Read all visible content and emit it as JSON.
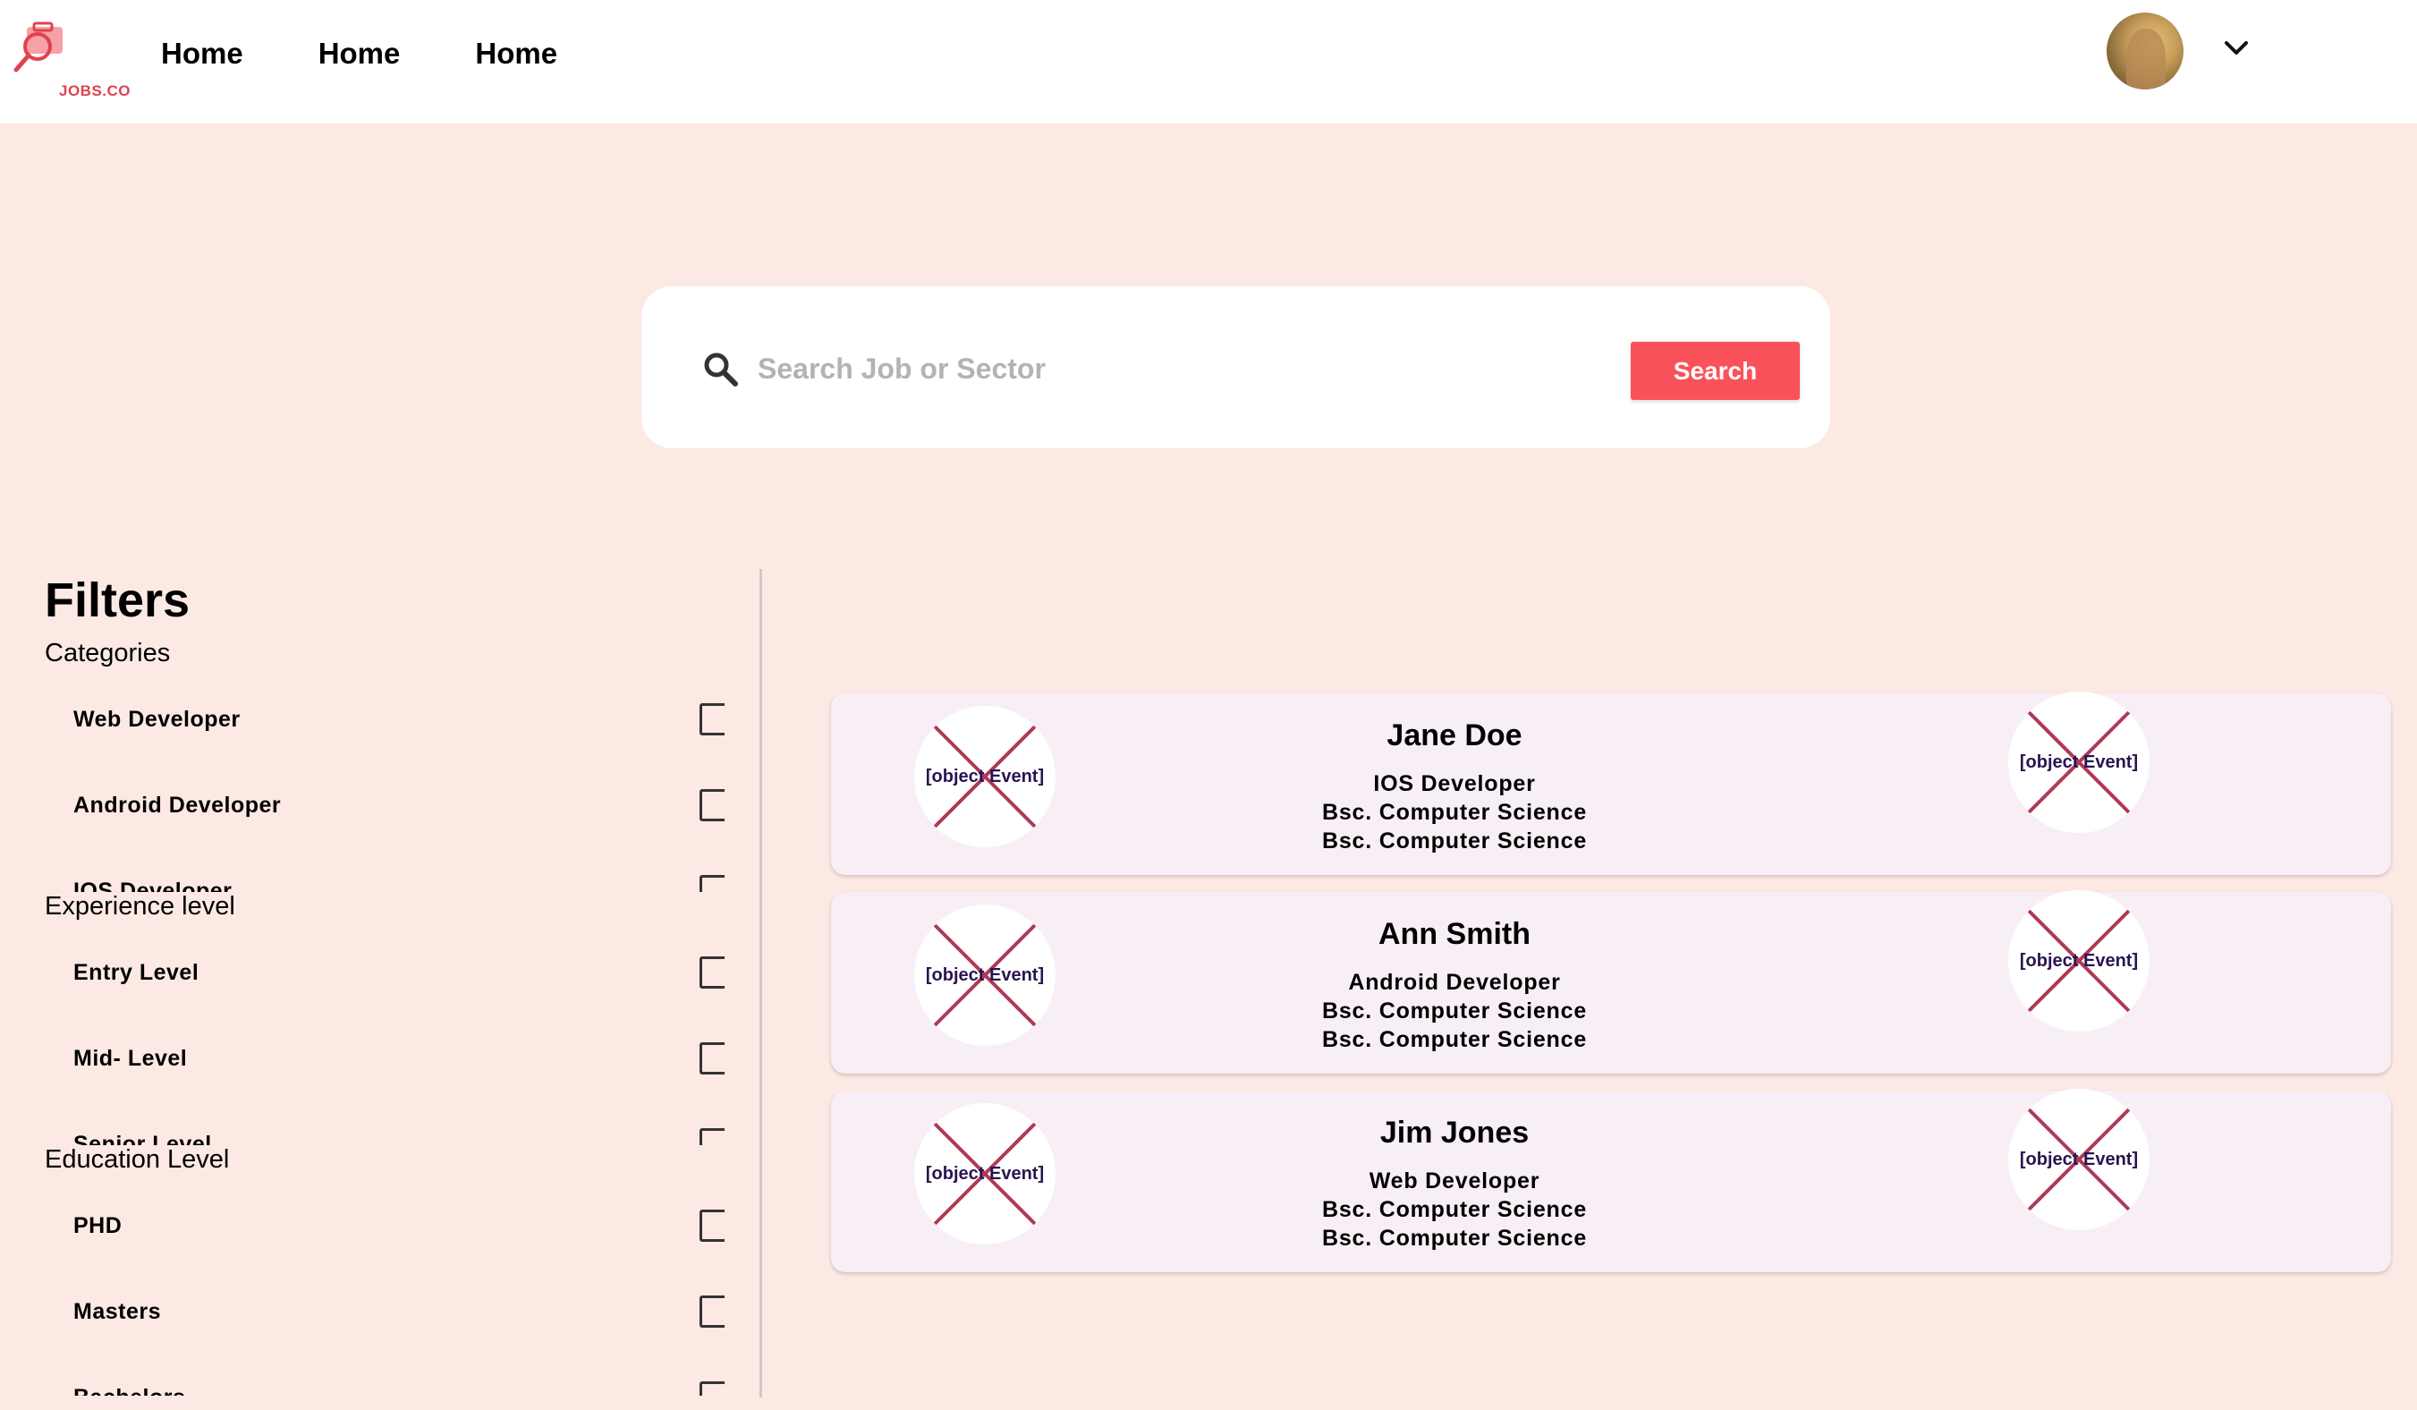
{
  "header": {
    "logo_text": "JOBS.CO",
    "nav": [
      "Home",
      "Home",
      "Home"
    ]
  },
  "search": {
    "placeholder": "Search Job or Sector",
    "button_label": "Search"
  },
  "filters": {
    "title": "Filters",
    "groups": [
      {
        "title": "Categories",
        "items": [
          "Web Developer",
          "Android Developer",
          "IOS Developer"
        ]
      },
      {
        "title": "Experience level",
        "items": [
          "Entry Level",
          "Mid- Level",
          "Senior Level"
        ]
      },
      {
        "title": "Education Level",
        "items": [
          "PHD",
          "Masters",
          "Bachelors"
        ]
      }
    ]
  },
  "broken_image_text": "[object Event]",
  "candidates": [
    {
      "name": "Jane Doe",
      "role": "IOS Developer",
      "education": [
        "Bsc. Computer Science",
        "Bsc. Computer Science"
      ]
    },
    {
      "name": "Ann Smith",
      "role": "Android Developer",
      "education": [
        "Bsc. Computer Science",
        "Bsc. Computer Science"
      ]
    },
    {
      "name": "Jim Jones",
      "role": "Web Developer",
      "education": [
        "Bsc. Computer Science",
        "Bsc. Computer Science"
      ]
    }
  ],
  "colors": {
    "accent": "#f9525a",
    "background": "#fde9e3",
    "card": "#f7eff5"
  }
}
